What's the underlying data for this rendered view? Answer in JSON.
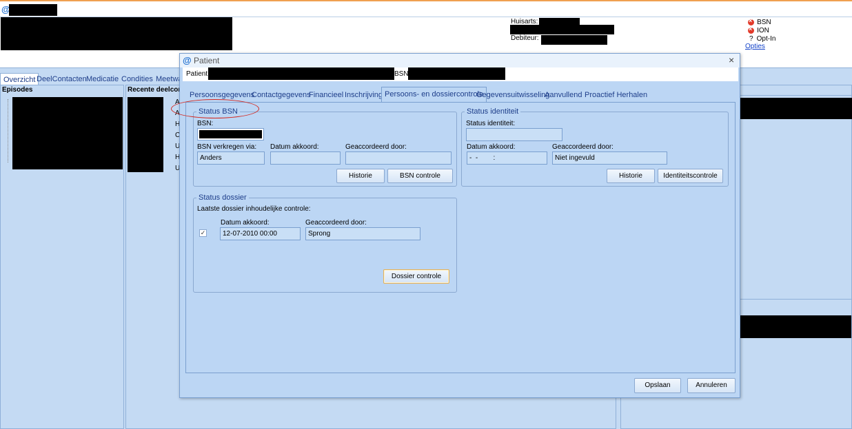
{
  "app": {
    "logo": "@"
  },
  "header": {
    "huisarts_label": "Huisarts:",
    "debiteur_label": "Debiteur:",
    "status": [
      {
        "icon": "error-icon",
        "label": "BSN"
      },
      {
        "icon": "error-icon",
        "label": "ION"
      },
      {
        "icon": "question-icon",
        "label": "Opt-In"
      }
    ],
    "opties_link": "Opties",
    "question_glyph": "?"
  },
  "main_tabs": [
    "Overzicht",
    "DeelContacten",
    "Medicatie",
    "Condities",
    "Meetwa"
  ],
  "left_panels": {
    "episodes_title": "Episodes",
    "recente_title": "Recente deelcon",
    "recente_letters": [
      "A",
      "A",
      "H",
      "C",
      "U",
      "H",
      "U"
    ]
  },
  "dialog": {
    "title_icon": "@",
    "title": "Patient",
    "close_glyph": "×",
    "patient_label": "Patient:",
    "bsn_label": "BSN:",
    "tabs": [
      "Persoonsgegevens",
      "Contactgegevens",
      "Financieel",
      "Inschrijving",
      "Persoons- en dossiercontrole",
      "Gegevensuitwisseling",
      "Aanvullend",
      "Proactief Herhalen"
    ],
    "status_bsn": {
      "legend": "Status BSN",
      "bsn_label": "BSN:",
      "verkregen_label": "BSN verkregen via:",
      "verkregen_value": "Anders",
      "datum_label": "Datum akkoord:",
      "datum_value": "",
      "geaccordeerd_label": "Geaccordeerd door:",
      "geaccordeerd_value": "",
      "historie_button": "Historie",
      "bsn_controle_button": "BSN controle"
    },
    "status_identiteit": {
      "legend": "Status identiteit",
      "status_label": "Status identiteit:",
      "status_value": "",
      "datum_label": "Datum akkoord:",
      "datum_value": "-  -        :",
      "geaccordeerd_label": "Geaccordeerd door:",
      "geaccordeerd_value": "Niet ingevuld",
      "historie_button": "Historie",
      "identiteit_button": "Identiteitscontrole"
    },
    "status_dossier": {
      "legend": "Status dossier",
      "laatste_label": "Laatste dossier inhoudelijke controle:",
      "check_glyph": "✓",
      "datum_label": "Datum akkoord:",
      "datum_value": "12-07-2010 00:00",
      "geaccordeerd_label": "Geaccordeerd door:",
      "geaccordeerd_value": "Sprong",
      "dossier_button": "Dossier controle"
    },
    "opslaan_button": "Opslaan",
    "annuleren_button": "Annuleren"
  }
}
